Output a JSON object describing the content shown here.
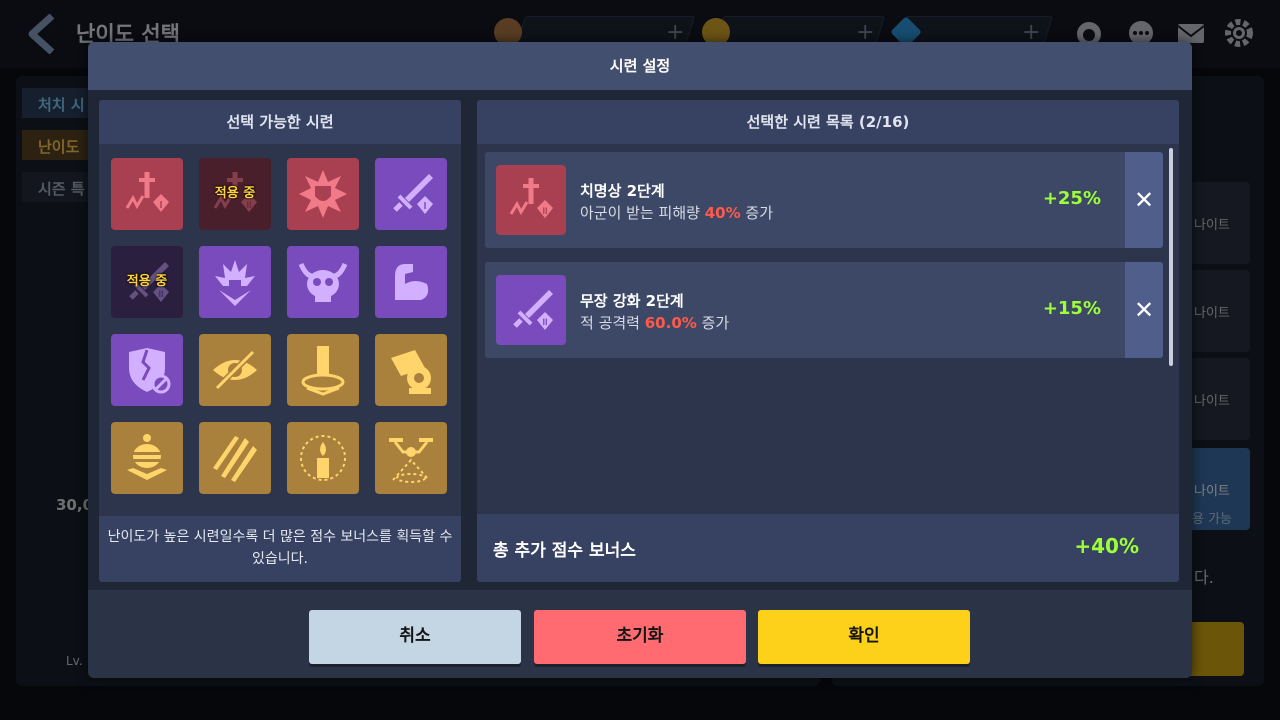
{
  "background": {
    "title": "난이도 선택",
    "tabs": [
      "처치 시",
      "난이도",
      "시즌 특"
    ],
    "level_text": "30,0",
    "lv_text": "Lv.",
    "cards": [
      "나이트",
      "나이트",
      "나이트",
      "나이트"
    ],
    "card_sub": "용 가능",
    "side_text": "다."
  },
  "modal": {
    "title": "시련 설정",
    "available": {
      "header": "선택 가능한 시련",
      "active_label": "적용 중",
      "footer": "난이도가 높은 시련일수록 더 많은 점수 보너스를 획득할 수 있습니다.",
      "trials": [
        {
          "icon": "fatal-wound-icon",
          "color": "red",
          "active": false
        },
        {
          "icon": "fatal-wound-2-icon",
          "color": "red",
          "active": true
        },
        {
          "icon": "explosion-shield-icon",
          "color": "red",
          "active": false
        },
        {
          "icon": "sword-upgrade-icon",
          "color": "purple",
          "active": false
        },
        {
          "icon": "sword-upgrade-2-icon",
          "color": "purple",
          "active": true
        },
        {
          "icon": "spike-burst-icon",
          "color": "purple",
          "active": false
        },
        {
          "icon": "horned-skull-icon",
          "color": "purple",
          "active": false
        },
        {
          "icon": "flexed-arm-icon",
          "color": "purple",
          "active": false
        },
        {
          "icon": "broken-shield-icon",
          "color": "purple",
          "active": false
        },
        {
          "icon": "hidden-eye-icon",
          "color": "gold",
          "active": false
        },
        {
          "icon": "pillar-drop-icon",
          "color": "gold",
          "active": false
        },
        {
          "icon": "cannon-icon",
          "color": "gold",
          "active": false
        },
        {
          "icon": "bee-badge-icon",
          "color": "gold",
          "active": false
        },
        {
          "icon": "claw-slash-icon",
          "color": "gold",
          "active": false
        },
        {
          "icon": "candle-icon",
          "color": "gold",
          "active": false
        },
        {
          "icon": "drone-icon",
          "color": "gold",
          "active": false
        }
      ]
    },
    "selected": {
      "header": "선택한 시련 목록 (2/16)",
      "items": [
        {
          "name": "치명상 2단계",
          "desc_prefix": "아군이 받는 피해량 ",
          "desc_value": "40%",
          "desc_suffix": " 증가",
          "bonus": "+25%",
          "icon": "fatal-wound-2-icon",
          "color": "red"
        },
        {
          "name": "무장 강화 2단계",
          "desc_prefix": "적 공격력 ",
          "desc_value": "60.0%",
          "desc_suffix": " 증가",
          "bonus": "+15%",
          "icon": "sword-upgrade-2-icon",
          "color": "purple"
        }
      ],
      "remove_label": "✕",
      "total_label": "총 추가 점수 보너스",
      "total_value": "+40%"
    },
    "buttons": {
      "cancel": "취소",
      "reset": "초기화",
      "confirm": "확인"
    }
  },
  "colors": {
    "red": "#a94052",
    "purple": "#7a4bbd",
    "gold": "#a9803c",
    "bonus_green": "#9cff3a",
    "highlight_red": "#ff5a4a"
  }
}
